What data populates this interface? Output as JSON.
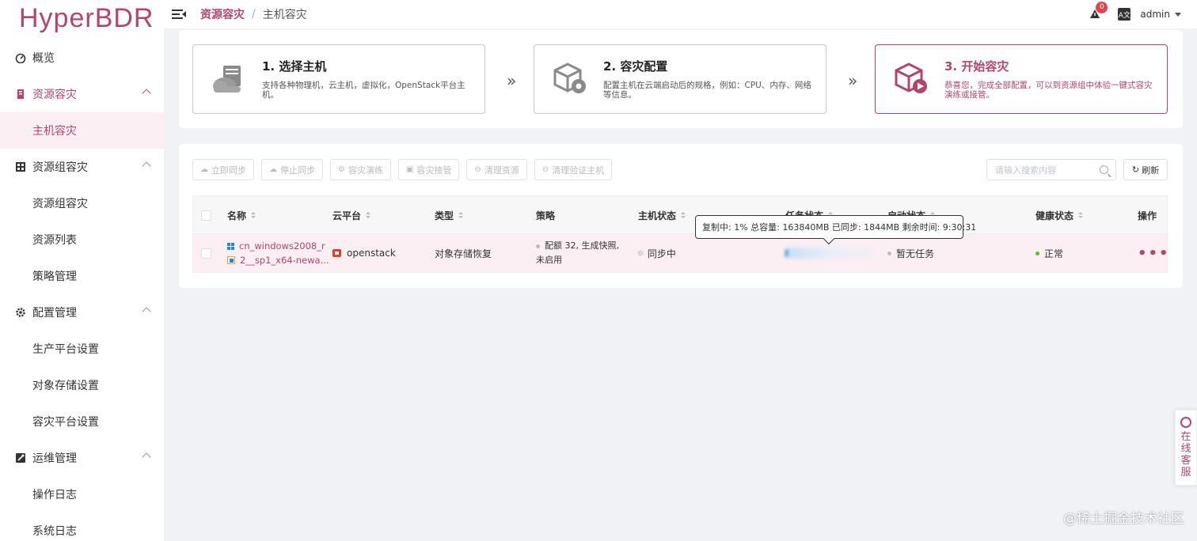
{
  "app": {
    "logo": "HyperBDR"
  },
  "sidebar": {
    "items": [
      {
        "label": "概览",
        "icon": "dashboard-icon"
      },
      {
        "label": "资源容灾",
        "icon": "server-icon",
        "children": [
          {
            "label": "主机容灾",
            "active": true
          }
        ]
      },
      {
        "label": "资源组容灾",
        "icon": "grid-icon",
        "children": [
          {
            "label": "资源组容灾"
          },
          {
            "label": "资源列表"
          },
          {
            "label": "策略管理"
          }
        ]
      },
      {
        "label": "配置管理",
        "icon": "gear-icon",
        "children": [
          {
            "label": "生产平台设置"
          },
          {
            "label": "对象存储设置"
          },
          {
            "label": "容灾平台设置"
          }
        ]
      },
      {
        "label": "运维管理",
        "icon": "tools-icon",
        "children": [
          {
            "label": "操作日志"
          },
          {
            "label": "系统日志"
          }
        ]
      }
    ]
  },
  "header": {
    "breadcrumb": {
      "parent": "资源容灾",
      "separator": "/",
      "current": "主机容灾"
    },
    "notification_count": "0",
    "lang_icon_text": "A文",
    "user": "admin"
  },
  "steps": [
    {
      "title": "1. 选择主机",
      "desc": "支持各种物理机，云主机，虚拟化，OpenStack平台主机。",
      "icon": "cloud-server-icon",
      "active": false
    },
    {
      "title": "2. 容灾配置",
      "desc": "配置主机在云端启动后的规格，例如：CPU、内存、网络等信息。",
      "icon": "box-gear-icon",
      "active": false
    },
    {
      "title": "3. 开始容灾",
      "desc": "恭喜您，完成全部配置，可以到资源组中体验一键式容灾演练或接管。",
      "icon": "box-play-icon",
      "active": true
    }
  ],
  "step_separator": "»",
  "toolbar": {
    "buttons": [
      "立即同步",
      "停止同步",
      "容灾演练",
      "容灾接管",
      "清理资源",
      "清理验证主机"
    ],
    "search_placeholder": "请输入搜索内容",
    "refresh_label": "刷新"
  },
  "table": {
    "headers": [
      "名称",
      "云平台",
      "类型",
      "策略",
      "主机状态",
      "任务状态",
      "启动状态",
      "健康状态",
      "操作"
    ],
    "rows": [
      {
        "name_line1": "cn_windows2008_r",
        "name_line2": "2__sp1_x64-newa...",
        "platform": "openstack",
        "type": "对象存储恢复",
        "policy_line1": "配额 32, 生成快照,",
        "policy_line2": "未启用",
        "host_status": "同步中",
        "task_progress": 0.01,
        "boot_status": "暂无任务",
        "health": "正常",
        "action": "•••"
      }
    ]
  },
  "tooltip": "复制中: 1% 总容量: 163840MB 已同步: 1844MB 剩余时间: 9:30:31",
  "colors": {
    "accent": "#b4456a",
    "health_ok": "#52c41a",
    "progress": "#1e88e5"
  },
  "customer_service": {
    "label_chars": [
      "在",
      "线",
      "客",
      "服"
    ]
  },
  "watermark": "@稀土掘金技术社区"
}
